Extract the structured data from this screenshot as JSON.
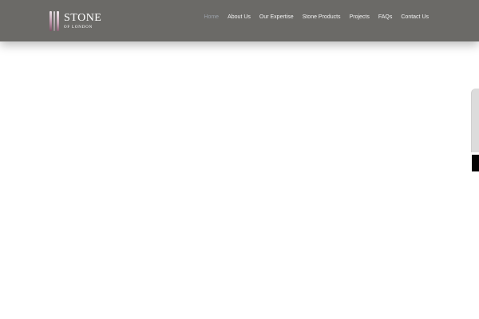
{
  "header": {
    "logo": {
      "word": "STONE",
      "subtitle": "OF LONDON"
    },
    "nav": [
      {
        "label": "Home",
        "active": true
      },
      {
        "label": "About Us",
        "active": false
      },
      {
        "label": "Our Expertise",
        "active": false
      },
      {
        "label": "Stone Products",
        "active": false
      },
      {
        "label": "Projects",
        "active": false
      },
      {
        "label": "FAQs",
        "active": false
      },
      {
        "label": "Contact Us",
        "active": false
      }
    ],
    "background_color": "#6b6a67",
    "active_color": "#9aa0a8"
  }
}
